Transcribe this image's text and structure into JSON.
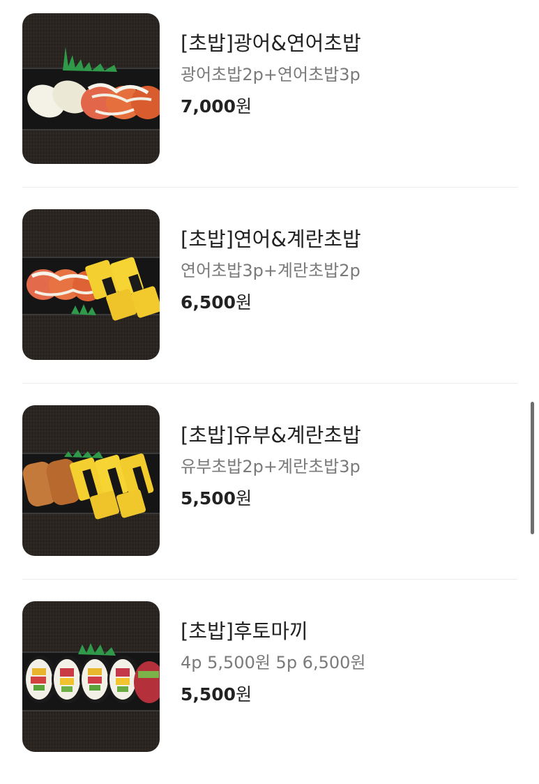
{
  "menu": {
    "items": [
      {
        "name": "[초밥]광어&연어초밥",
        "description": "광어초밥2p+연어초밥3p",
        "price": "7,000",
        "currency": "원",
        "image_icon": "flatfish-salmon-sushi-photo"
      },
      {
        "name": "[초밥]연어&계란초밥",
        "description": "연어초밥3p+계란초밥2p",
        "price": "6,500",
        "currency": "원",
        "image_icon": "salmon-egg-sushi-photo"
      },
      {
        "name": "[초밥]유부&계란초밥",
        "description": "유부초밥2p+계란초밥3p",
        "price": "5,500",
        "currency": "원",
        "image_icon": "inari-egg-sushi-photo"
      },
      {
        "name": "[초밥]후토마끼",
        "description": "4p 5,500원 5p 6,500원",
        "price": "5,500",
        "currency": "원",
        "image_icon": "futomaki-photo"
      }
    ]
  },
  "colors": {
    "background": "#ffffff",
    "title_text": "#222222",
    "description_text": "#7a7a7a",
    "divider": "#ececec",
    "scrollbar": "#6e6e6e"
  }
}
